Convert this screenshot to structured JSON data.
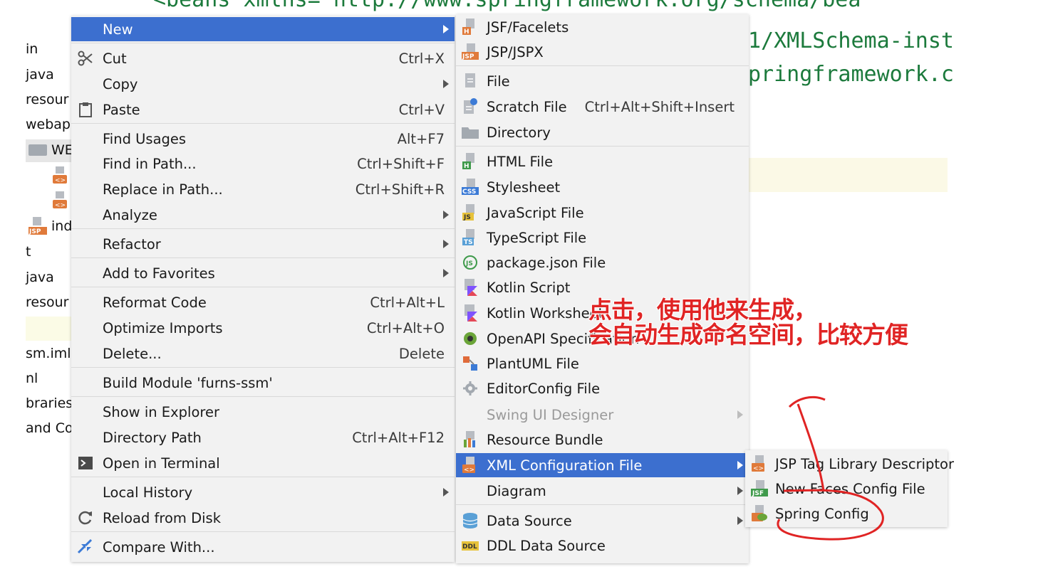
{
  "editor": {
    "line_top": "<beans xmlns=\"http://www.springframework.org/schema/bea",
    "line2": "1/XMLSchema-inst",
    "line3": "pringframework.c"
  },
  "project_tree": {
    "items": [
      {
        "label": "in"
      },
      {
        "label": "java"
      },
      {
        "label": "resour"
      },
      {
        "label": "webap"
      },
      {
        "label": "WE"
      },
      {
        "label": "ind"
      },
      {
        "label": "t"
      },
      {
        "label": "java"
      },
      {
        "label": "resour"
      },
      {
        "label": "sm.iml"
      },
      {
        "label": "nl"
      },
      {
        "label": "braries"
      },
      {
        "label": "and Co"
      }
    ]
  },
  "context_menu": {
    "new": {
      "label": "New",
      "has_submenu": true
    },
    "cut": {
      "label": "Cut",
      "shortcut": "Ctrl+X",
      "icon": "scissors-icon"
    },
    "copy": {
      "label": "Copy",
      "has_submenu": true
    },
    "paste": {
      "label": "Paste",
      "shortcut": "Ctrl+V",
      "icon": "clipboard-icon"
    },
    "find_usages": {
      "label": "Find Usages",
      "shortcut": "Alt+F7"
    },
    "find_in_path": {
      "label": "Find in Path...",
      "shortcut": "Ctrl+Shift+F"
    },
    "replace_in_path": {
      "label": "Replace in Path...",
      "shortcut": "Ctrl+Shift+R"
    },
    "analyze": {
      "label": "Analyze",
      "has_submenu": true
    },
    "refactor": {
      "label": "Refactor",
      "has_submenu": true
    },
    "add_to_favorites": {
      "label": "Add to Favorites",
      "has_submenu": true
    },
    "reformat_code": {
      "label": "Reformat Code",
      "shortcut": "Ctrl+Alt+L"
    },
    "optimize_imports": {
      "label": "Optimize Imports",
      "shortcut": "Ctrl+Alt+O"
    },
    "delete": {
      "label": "Delete...",
      "shortcut": "Delete"
    },
    "build_module": {
      "label": "Build Module 'furns-ssm'"
    },
    "show_in_explorer": {
      "label": "Show in Explorer"
    },
    "directory_path": {
      "label": "Directory Path",
      "shortcut": "Ctrl+Alt+F12"
    },
    "open_in_terminal": {
      "label": "Open in Terminal",
      "icon": "terminal-icon"
    },
    "local_history": {
      "label": "Local History",
      "has_submenu": true
    },
    "reload_from_disk": {
      "label": "Reload from Disk",
      "icon": "reload-icon"
    },
    "compare_with": {
      "label": "Compare With...",
      "icon": "compare-icon"
    }
  },
  "new_submenu": {
    "jsf": {
      "label": "JSF/Facelets",
      "tag": "H"
    },
    "jsp": {
      "label": "JSP/JSPX",
      "tag": "JSP"
    },
    "file": {
      "label": "File"
    },
    "scratch": {
      "label": "Scratch File",
      "shortcut": "Ctrl+Alt+Shift+Insert"
    },
    "directory": {
      "label": "Directory"
    },
    "html": {
      "label": "HTML File",
      "tag": "H"
    },
    "stylesheet": {
      "label": "Stylesheet",
      "tag": "CSS"
    },
    "javascript": {
      "label": "JavaScript File",
      "tag": "JS"
    },
    "typescript": {
      "label": "TypeScript File",
      "tag": "TS"
    },
    "package_json": {
      "label": "package.json File"
    },
    "kotlin_script": {
      "label": "Kotlin Script"
    },
    "kotlin_worksheet": {
      "label": "Kotlin Worksheet"
    },
    "openapi": {
      "label": "OpenAPI Specification"
    },
    "plantuml": {
      "label": "PlantUML File"
    },
    "editorconfig": {
      "label": "EditorConfig File"
    },
    "swing": {
      "label": "Swing UI Designer",
      "disabled": true,
      "has_submenu": true
    },
    "resource_bundle": {
      "label": "Resource Bundle"
    },
    "xml_config": {
      "label": "XML Configuration File",
      "has_submenu": true
    },
    "diagram": {
      "label": "Diagram",
      "has_submenu": true
    },
    "data_source": {
      "label": "Data Source",
      "has_submenu": true
    },
    "ddl_data_source": {
      "label": "DDL Data Source",
      "tag": "DDL"
    }
  },
  "xml_submenu": {
    "jsp_tag": {
      "label": "JSP Tag Library Descriptor"
    },
    "faces_config": {
      "label": "New Faces Config File",
      "tag": "JSF"
    },
    "spring_config": {
      "label": "Spring Config"
    }
  },
  "annotation": {
    "line1": "点击，使用他来生成，",
    "line2": "会自动生成命名空间，比较方便"
  },
  "colors": {
    "active_item": "#3c6fcf",
    "menu_bg": "#f2f2f2",
    "annotation": "#e02424",
    "code": "#1c7a3c"
  }
}
